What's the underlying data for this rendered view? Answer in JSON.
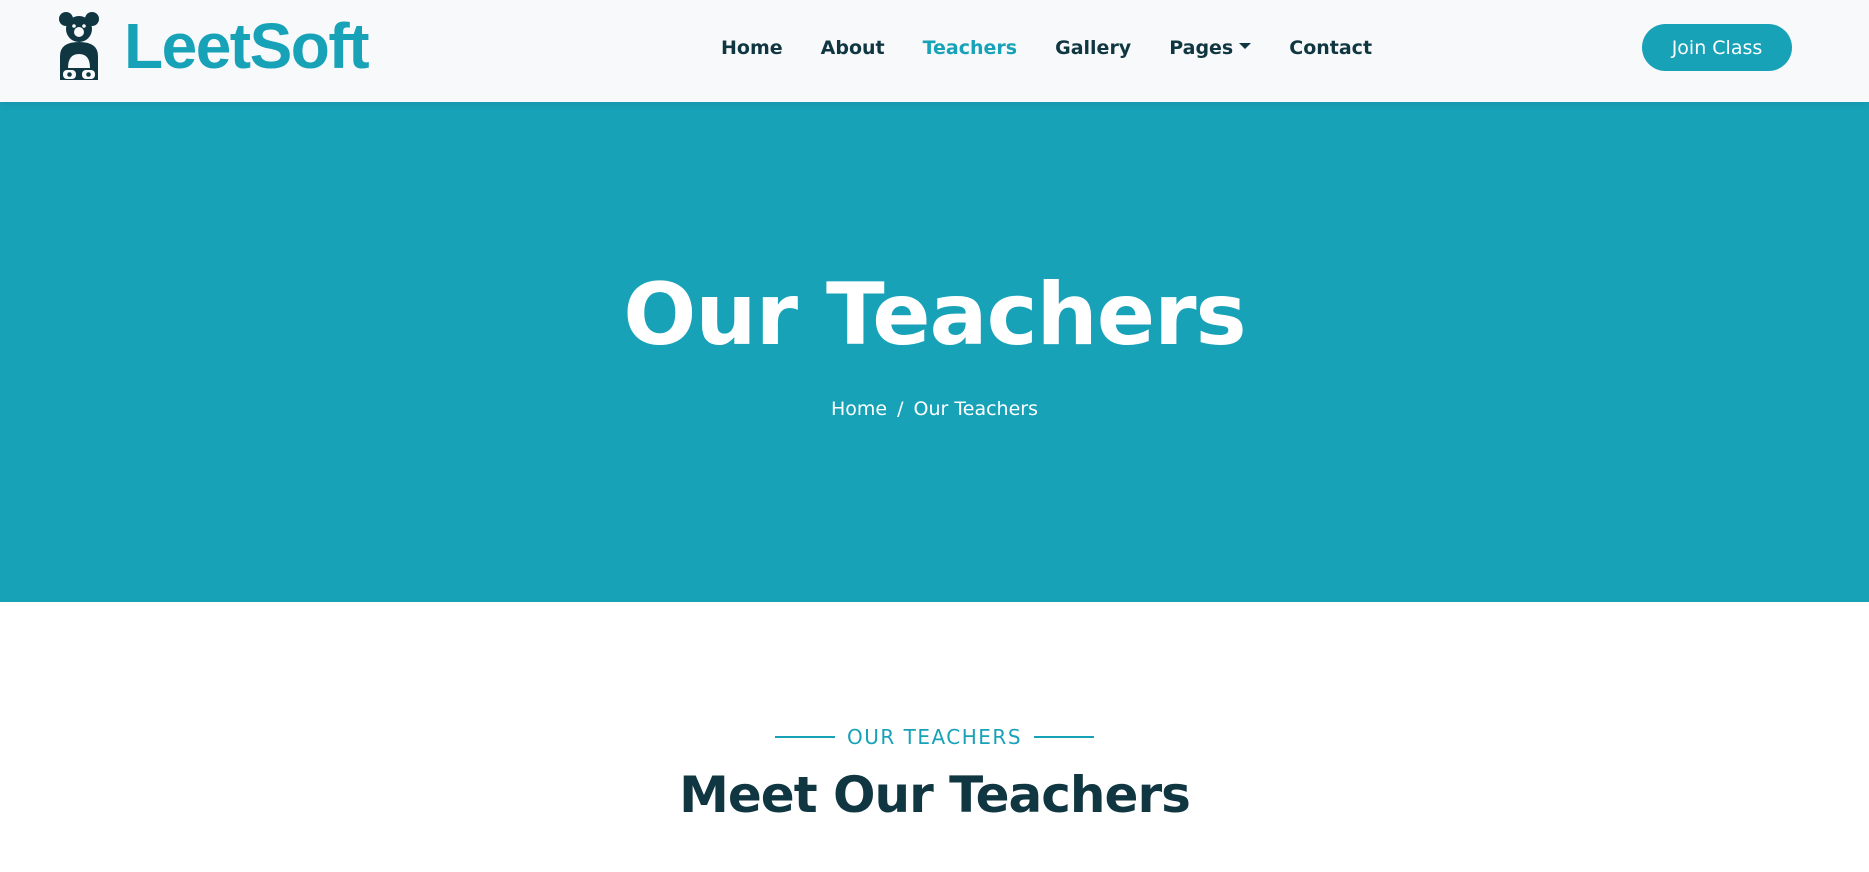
{
  "brand": {
    "name": "LeetSoft",
    "icon": "teddy-bear-icon",
    "color": "#17a2b8"
  },
  "nav": {
    "items": [
      {
        "label": "Home"
      },
      {
        "label": "About"
      },
      {
        "label": "Teachers",
        "active": true
      },
      {
        "label": "Gallery"
      },
      {
        "label": "Pages",
        "dropdown": true
      },
      {
        "label": "Contact"
      }
    ],
    "cta_label": "Join Class"
  },
  "hero": {
    "title": "Our Teachers",
    "breadcrumb": {
      "home": "Home",
      "separator": "/",
      "current": "Our Teachers"
    },
    "background": "#17a2b8"
  },
  "section": {
    "label": "OUR TEACHERS",
    "title": "Meet Our Teachers"
  },
  "colors": {
    "primary": "#17a2b8",
    "dark": "#103741",
    "navbar_bg": "#f7f9fa"
  }
}
